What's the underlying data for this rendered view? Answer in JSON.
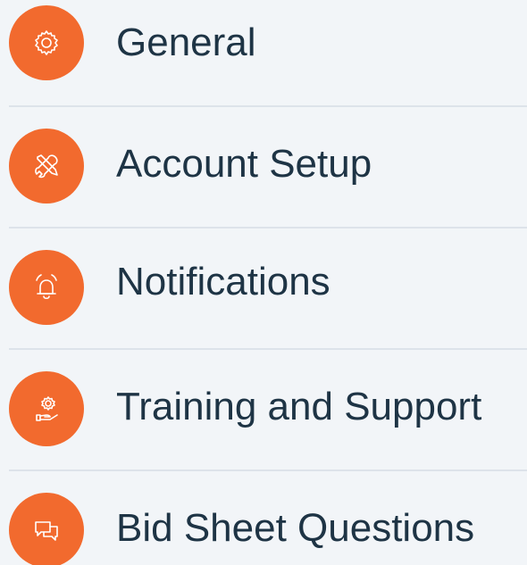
{
  "menu": {
    "items": [
      {
        "label": "General",
        "icon": "gear-icon"
      },
      {
        "label": "Account Setup",
        "icon": "tools-icon"
      },
      {
        "label": "Notifications",
        "icon": "alarm-bell-icon"
      },
      {
        "label": "Training and Support",
        "icon": "hand-gear-icon"
      },
      {
        "label": "Bid Sheet Questions",
        "icon": "chat-bubbles-icon"
      }
    ]
  },
  "colors": {
    "background": "#f2f5f8",
    "icon_circle": "#f26a2e",
    "icon_stroke": "#ffffff",
    "label_text": "#1e3445",
    "divider": "#dde3ea"
  }
}
